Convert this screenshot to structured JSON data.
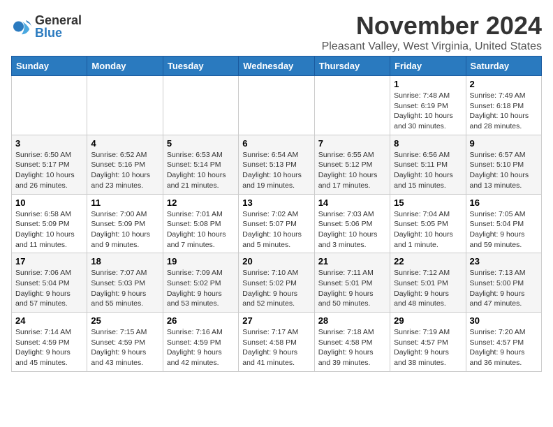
{
  "header": {
    "logo": {
      "general": "General",
      "blue": "Blue"
    },
    "title": "November 2024",
    "location": "Pleasant Valley, West Virginia, United States"
  },
  "weekdays": [
    "Sunday",
    "Monday",
    "Tuesday",
    "Wednesday",
    "Thursday",
    "Friday",
    "Saturday"
  ],
  "weeks": [
    [
      {
        "day": "",
        "info": ""
      },
      {
        "day": "",
        "info": ""
      },
      {
        "day": "",
        "info": ""
      },
      {
        "day": "",
        "info": ""
      },
      {
        "day": "",
        "info": ""
      },
      {
        "day": "1",
        "info": "Sunrise: 7:48 AM\nSunset: 6:19 PM\nDaylight: 10 hours and 30 minutes."
      },
      {
        "day": "2",
        "info": "Sunrise: 7:49 AM\nSunset: 6:18 PM\nDaylight: 10 hours and 28 minutes."
      }
    ],
    [
      {
        "day": "3",
        "info": "Sunrise: 6:50 AM\nSunset: 5:17 PM\nDaylight: 10 hours and 26 minutes."
      },
      {
        "day": "4",
        "info": "Sunrise: 6:52 AM\nSunset: 5:16 PM\nDaylight: 10 hours and 23 minutes."
      },
      {
        "day": "5",
        "info": "Sunrise: 6:53 AM\nSunset: 5:14 PM\nDaylight: 10 hours and 21 minutes."
      },
      {
        "day": "6",
        "info": "Sunrise: 6:54 AM\nSunset: 5:13 PM\nDaylight: 10 hours and 19 minutes."
      },
      {
        "day": "7",
        "info": "Sunrise: 6:55 AM\nSunset: 5:12 PM\nDaylight: 10 hours and 17 minutes."
      },
      {
        "day": "8",
        "info": "Sunrise: 6:56 AM\nSunset: 5:11 PM\nDaylight: 10 hours and 15 minutes."
      },
      {
        "day": "9",
        "info": "Sunrise: 6:57 AM\nSunset: 5:10 PM\nDaylight: 10 hours and 13 minutes."
      }
    ],
    [
      {
        "day": "10",
        "info": "Sunrise: 6:58 AM\nSunset: 5:09 PM\nDaylight: 10 hours and 11 minutes."
      },
      {
        "day": "11",
        "info": "Sunrise: 7:00 AM\nSunset: 5:09 PM\nDaylight: 10 hours and 9 minutes."
      },
      {
        "day": "12",
        "info": "Sunrise: 7:01 AM\nSunset: 5:08 PM\nDaylight: 10 hours and 7 minutes."
      },
      {
        "day": "13",
        "info": "Sunrise: 7:02 AM\nSunset: 5:07 PM\nDaylight: 10 hours and 5 minutes."
      },
      {
        "day": "14",
        "info": "Sunrise: 7:03 AM\nSunset: 5:06 PM\nDaylight: 10 hours and 3 minutes."
      },
      {
        "day": "15",
        "info": "Sunrise: 7:04 AM\nSunset: 5:05 PM\nDaylight: 10 hours and 1 minute."
      },
      {
        "day": "16",
        "info": "Sunrise: 7:05 AM\nSunset: 5:04 PM\nDaylight: 9 hours and 59 minutes."
      }
    ],
    [
      {
        "day": "17",
        "info": "Sunrise: 7:06 AM\nSunset: 5:04 PM\nDaylight: 9 hours and 57 minutes."
      },
      {
        "day": "18",
        "info": "Sunrise: 7:07 AM\nSunset: 5:03 PM\nDaylight: 9 hours and 55 minutes."
      },
      {
        "day": "19",
        "info": "Sunrise: 7:09 AM\nSunset: 5:02 PM\nDaylight: 9 hours and 53 minutes."
      },
      {
        "day": "20",
        "info": "Sunrise: 7:10 AM\nSunset: 5:02 PM\nDaylight: 9 hours and 52 minutes."
      },
      {
        "day": "21",
        "info": "Sunrise: 7:11 AM\nSunset: 5:01 PM\nDaylight: 9 hours and 50 minutes."
      },
      {
        "day": "22",
        "info": "Sunrise: 7:12 AM\nSunset: 5:01 PM\nDaylight: 9 hours and 48 minutes."
      },
      {
        "day": "23",
        "info": "Sunrise: 7:13 AM\nSunset: 5:00 PM\nDaylight: 9 hours and 47 minutes."
      }
    ],
    [
      {
        "day": "24",
        "info": "Sunrise: 7:14 AM\nSunset: 4:59 PM\nDaylight: 9 hours and 45 minutes."
      },
      {
        "day": "25",
        "info": "Sunrise: 7:15 AM\nSunset: 4:59 PM\nDaylight: 9 hours and 43 minutes."
      },
      {
        "day": "26",
        "info": "Sunrise: 7:16 AM\nSunset: 4:59 PM\nDaylight: 9 hours and 42 minutes."
      },
      {
        "day": "27",
        "info": "Sunrise: 7:17 AM\nSunset: 4:58 PM\nDaylight: 9 hours and 41 minutes."
      },
      {
        "day": "28",
        "info": "Sunrise: 7:18 AM\nSunset: 4:58 PM\nDaylight: 9 hours and 39 minutes."
      },
      {
        "day": "29",
        "info": "Sunrise: 7:19 AM\nSunset: 4:57 PM\nDaylight: 9 hours and 38 minutes."
      },
      {
        "day": "30",
        "info": "Sunrise: 7:20 AM\nSunset: 4:57 PM\nDaylight: 9 hours and 36 minutes."
      }
    ]
  ]
}
